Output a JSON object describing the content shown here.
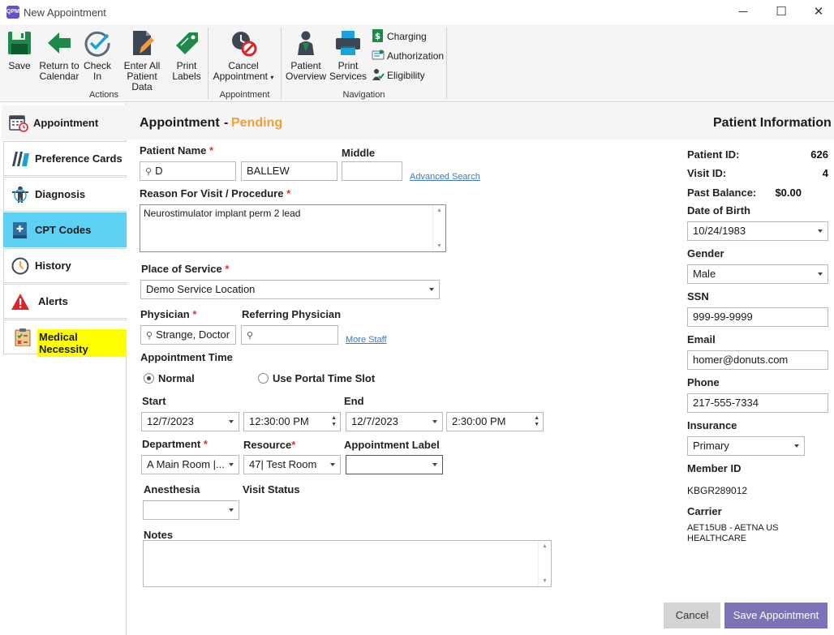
{
  "window": {
    "title": "New Appointment",
    "app_icon_text": "QPM",
    "minimize": "─",
    "maximize": "☐",
    "close": "✕"
  },
  "ribbon": {
    "actions": {
      "label": "Actions",
      "save": "Save",
      "return_to_calendar": [
        "Return to",
        "Calendar"
      ],
      "check_in": [
        "Check",
        "In"
      ],
      "enter_all_patient_data": [
        "Enter All",
        "Patient Data"
      ],
      "print_labels": [
        "Print",
        "Labels"
      ]
    },
    "appointment": {
      "label": "Appointment",
      "cancel_appointment": [
        "Cancel",
        "Appointment"
      ]
    },
    "navigation": {
      "label": "Navigation",
      "patient_overview": [
        "Patient",
        "Overview"
      ],
      "print_services": [
        "Print",
        "Services"
      ],
      "charging": "Charging",
      "authorization": "Authorization",
      "eligibility": "Eligibility"
    }
  },
  "sidebar": {
    "items": [
      {
        "label": "Appointment"
      },
      {
        "label": "Preference Cards"
      },
      {
        "label": "Diagnosis"
      },
      {
        "label": "CPT Codes"
      },
      {
        "label": "History"
      },
      {
        "label": "Alerts"
      },
      {
        "label": "Medical Necessity"
      }
    ]
  },
  "header": {
    "title": "Appointment",
    "separator": "-",
    "status": "Pending",
    "patient_info_title": "Patient Information"
  },
  "colors": {
    "status_pending": "#f0a13c",
    "sidebar_active": "#5dd0f3",
    "highlight_yellow": "#ffff00",
    "save_button": "#7b73b8",
    "required_star": "#d33333"
  },
  "form": {
    "patient_name_label": "Patient Name",
    "required_mark": "*",
    "middle_label": "Middle",
    "first_name": "D",
    "last_name": "BALLEW",
    "middle_name": "",
    "advanced_search": "Advanced Search",
    "reason_label": "Reason For Visit / Procedure",
    "reason_value": "Neurostimulator implant perm 2 lead",
    "place_of_service_label": "Place of Service",
    "place_of_service_value": "Demo Service Location",
    "physician_label": "Physician",
    "physician_value": "Strange, Doctor",
    "referring_physician_label": "Referring Physician",
    "referring_physician_value": "",
    "more_staff": "More Staff",
    "appointment_time_label": "Appointment Time",
    "normal_label": "Normal",
    "portal_label": "Use Portal Time Slot",
    "start_label": "Start",
    "start_date": "12/7/2023",
    "start_time": "12:30:00 PM",
    "end_label": "End",
    "end_date": "12/7/2023",
    "end_time": "2:30:00 PM",
    "department_label": "Department",
    "department_value": "A Main Room |...",
    "resource_label": "Resource",
    "resource_value": "47| Test Room",
    "appointment_label_label": "Appointment Label",
    "appointment_label_value": "",
    "anesthesia_label": "Anesthesia",
    "anesthesia_value": "",
    "visit_status_label": "Visit Status",
    "notes_label": "Notes",
    "notes_value": ""
  },
  "patient_info": {
    "patient_id_label": "Patient ID:",
    "patient_id": "626",
    "visit_id_label": "Visit ID:",
    "visit_id": "4",
    "past_balance_label": "Past Balance:",
    "past_balance": "$0.00",
    "dob_label": "Date of Birth",
    "dob": "10/24/1983",
    "gender_label": "Gender",
    "gender": "Male",
    "ssn_label": "SSN",
    "ssn": "999-99-9999",
    "email_label": "Email",
    "email": "homer@donuts.com",
    "phone_label": "Phone",
    "phone": "217-555-7334",
    "insurance_label": "Insurance",
    "insurance": "Primary",
    "member_id_label": "Member ID",
    "member_id": "KBGR289012",
    "carrier_label": "Carrier",
    "carrier": "AET15UB - AETNA US HEALTHCARE"
  },
  "footer": {
    "cancel": "Cancel",
    "save_appointment": "Save Appointment"
  }
}
